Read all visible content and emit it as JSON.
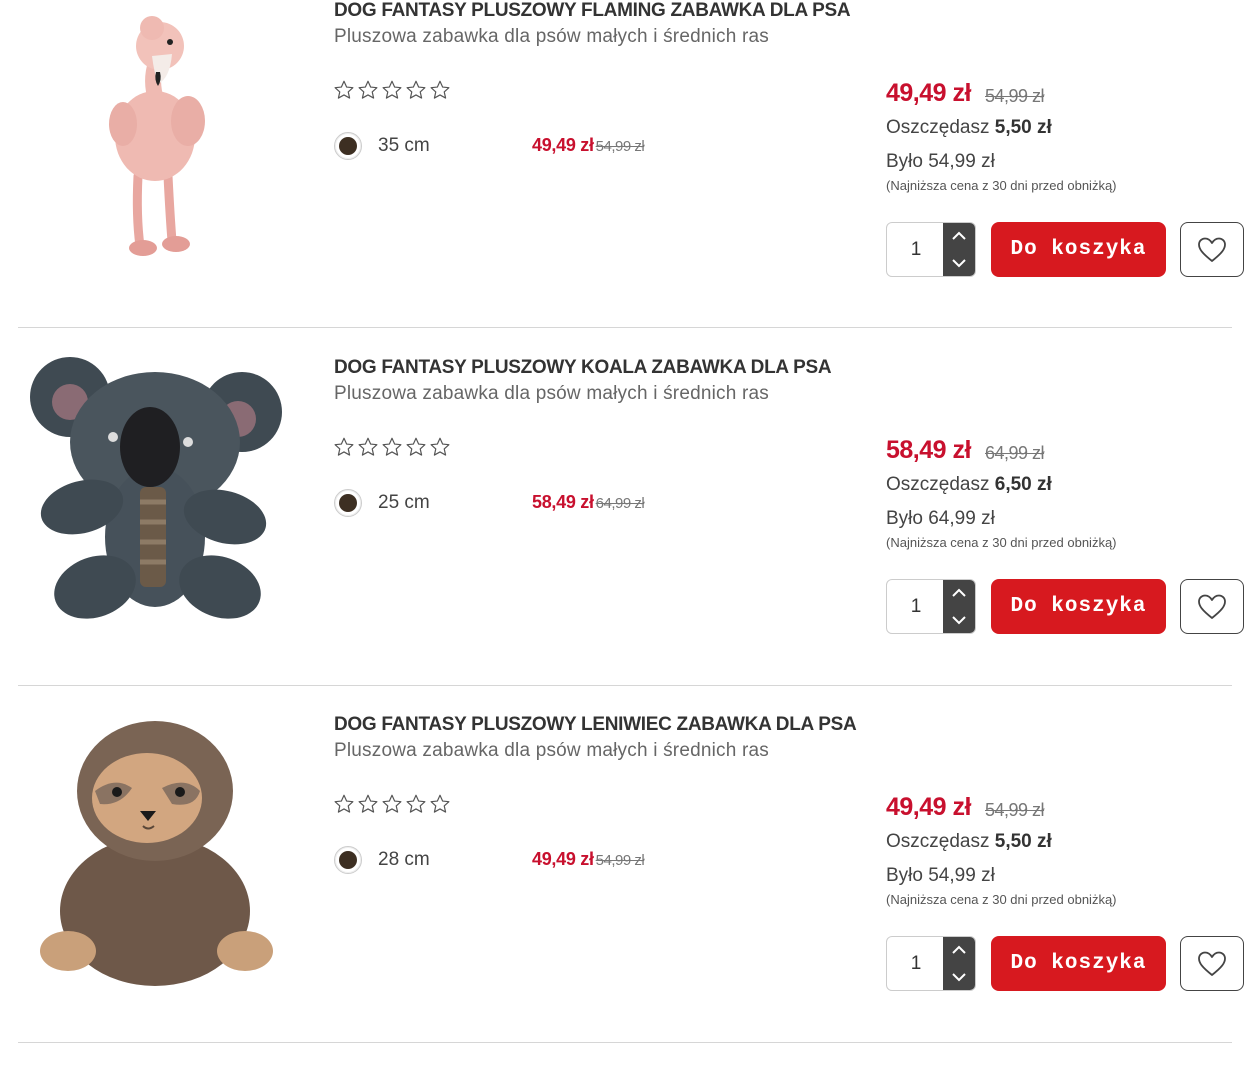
{
  "colors": {
    "accent": "#c8102e",
    "button": "#d7191f",
    "stepper": "#444444",
    "variant_dot": "#3d2f22"
  },
  "products": [
    {
      "title": "DOG FANTASY PLUSZOWY FLAMING ZABAWKA DLA PSA",
      "subtitle": "Pluszowa zabawka dla psów małych i średnich ras",
      "image_icon": "flamingo-plush",
      "rating_stars": 0,
      "variant_size": "35 cm",
      "variant_price": "49,49 zł",
      "variant_old_price": "54,99 zł",
      "price": "49,49 zł",
      "old_price": "54,99 zł",
      "savings_label": "Oszczędasz",
      "savings_value": "5,50 zł",
      "was_price": "Było 54,99 zł",
      "lowest_note": "(Najniższa cena z 30 dni przed obniżką)",
      "quantity": "1",
      "cart_label": "Do koszyka"
    },
    {
      "title": "DOG FANTASY PLUSZOWY KOALA ZABAWKA DLA PSA",
      "subtitle": "Pluszowa zabawka dla psów małych i średnich ras",
      "image_icon": "koala-plush",
      "rating_stars": 0,
      "variant_size": "25 cm",
      "variant_price": "58,49 zł",
      "variant_old_price": "64,99 zł",
      "price": "58,49 zł",
      "old_price": "64,99 zł",
      "savings_label": "Oszczędasz",
      "savings_value": "6,50 zł",
      "was_price": "Było 64,99 zł",
      "lowest_note": "(Najniższa cena z 30 dni przed obniżką)",
      "quantity": "1",
      "cart_label": "Do koszyka"
    },
    {
      "title": "DOG FANTASY PLUSZOWY LENIWIEC ZABAWKA DLA PSA",
      "subtitle": "Pluszowa zabawka dla psów małych i średnich ras",
      "image_icon": "sloth-plush",
      "rating_stars": 0,
      "variant_size": "28 cm",
      "variant_price": "49,49 zł",
      "variant_old_price": "54,99 zł",
      "price": "49,49 zł",
      "old_price": "54,99 zł",
      "savings_label": "Oszczędasz",
      "savings_value": "5,50 zł",
      "was_price": "Było 54,99 zł",
      "lowest_note": "(Najniższa cena z 30 dni przed obniżką)",
      "quantity": "1",
      "cart_label": "Do koszyka"
    }
  ]
}
